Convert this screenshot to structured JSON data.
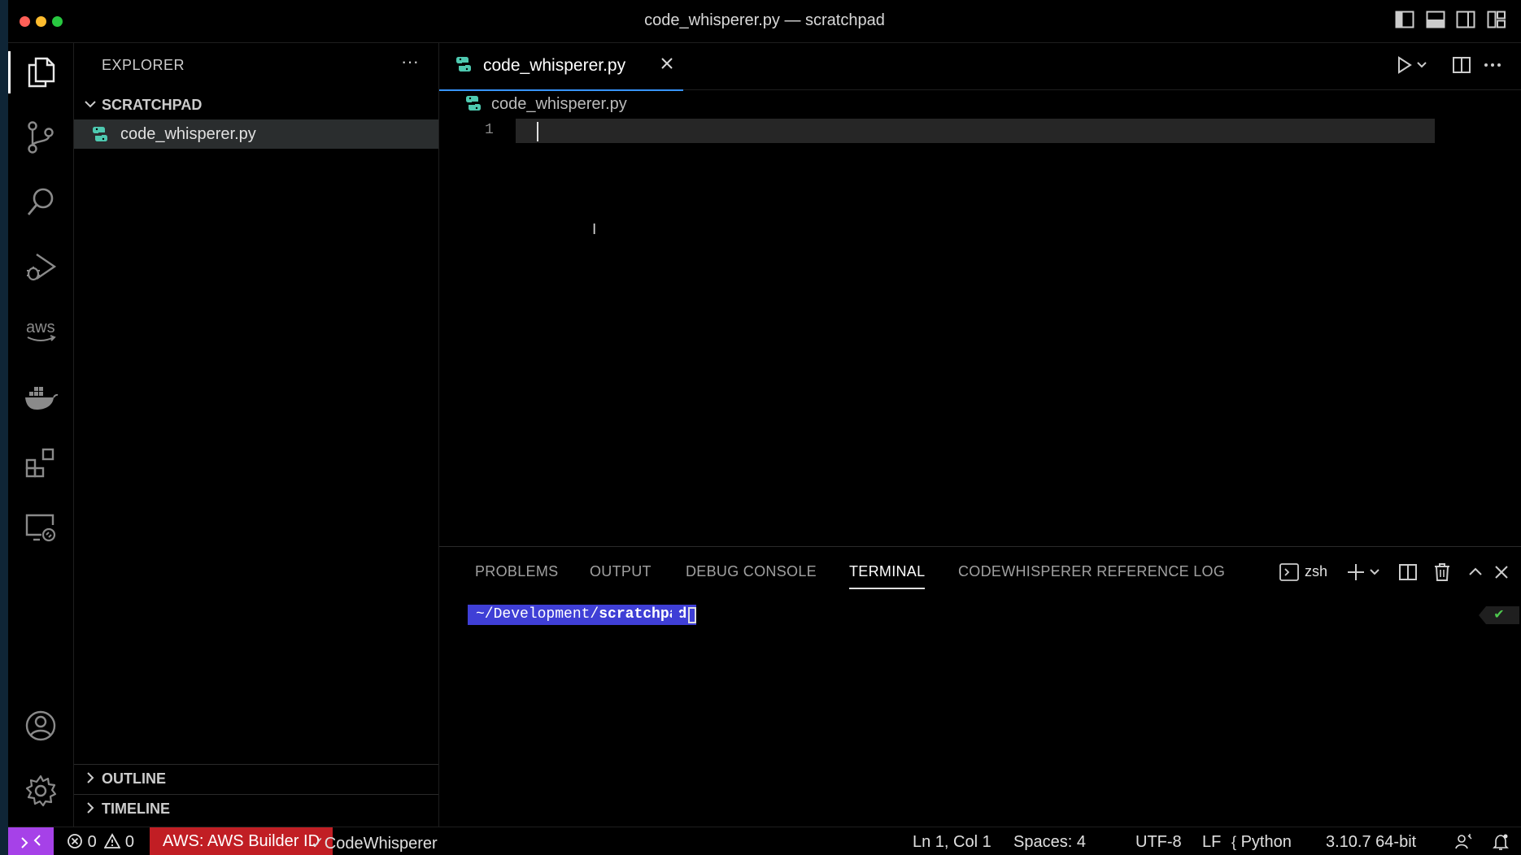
{
  "window": {
    "title": "code_whisperer.py — scratchpad"
  },
  "sidebar": {
    "title": "EXPLORER",
    "more_label": "···",
    "folder": "SCRATCHPAD",
    "files": [
      {
        "label": "code_whisperer.py"
      }
    ],
    "outline_label": "OUTLINE",
    "timeline_label": "TIMELINE"
  },
  "editor": {
    "tab_label": "code_whisperer.py",
    "breadcrumb_file": "code_whisperer.py",
    "line_number": "1"
  },
  "panel": {
    "tabs": [
      {
        "label": "PROBLEMS"
      },
      {
        "label": "OUTPUT"
      },
      {
        "label": "DEBUG CONSOLE"
      },
      {
        "label": "TERMINAL",
        "active": true
      },
      {
        "label": "CODEWHISPERER REFERENCE LOG"
      }
    ],
    "shell_label": "zsh",
    "prompt_path_prefix": "~/Development/",
    "prompt_path_dir": "scratchpad"
  },
  "status": {
    "errors": "0",
    "warnings": "0",
    "aws_label": "AWS: AWS Builder ID",
    "codewhisperer_label": "CodeWhisperer",
    "cursor_position": "Ln 1, Col 1",
    "indentation": "Spaces: 4",
    "encoding": "UTF-8",
    "eol": "LF",
    "language": "Python",
    "interpreter": "3.10.7 64-bit"
  },
  "colors": {
    "accent": "#3794ff",
    "remote": "#a641e8",
    "aws": "#c11e24",
    "prompt": "#3f3fd6",
    "python_icon": "#4ec9b0"
  }
}
